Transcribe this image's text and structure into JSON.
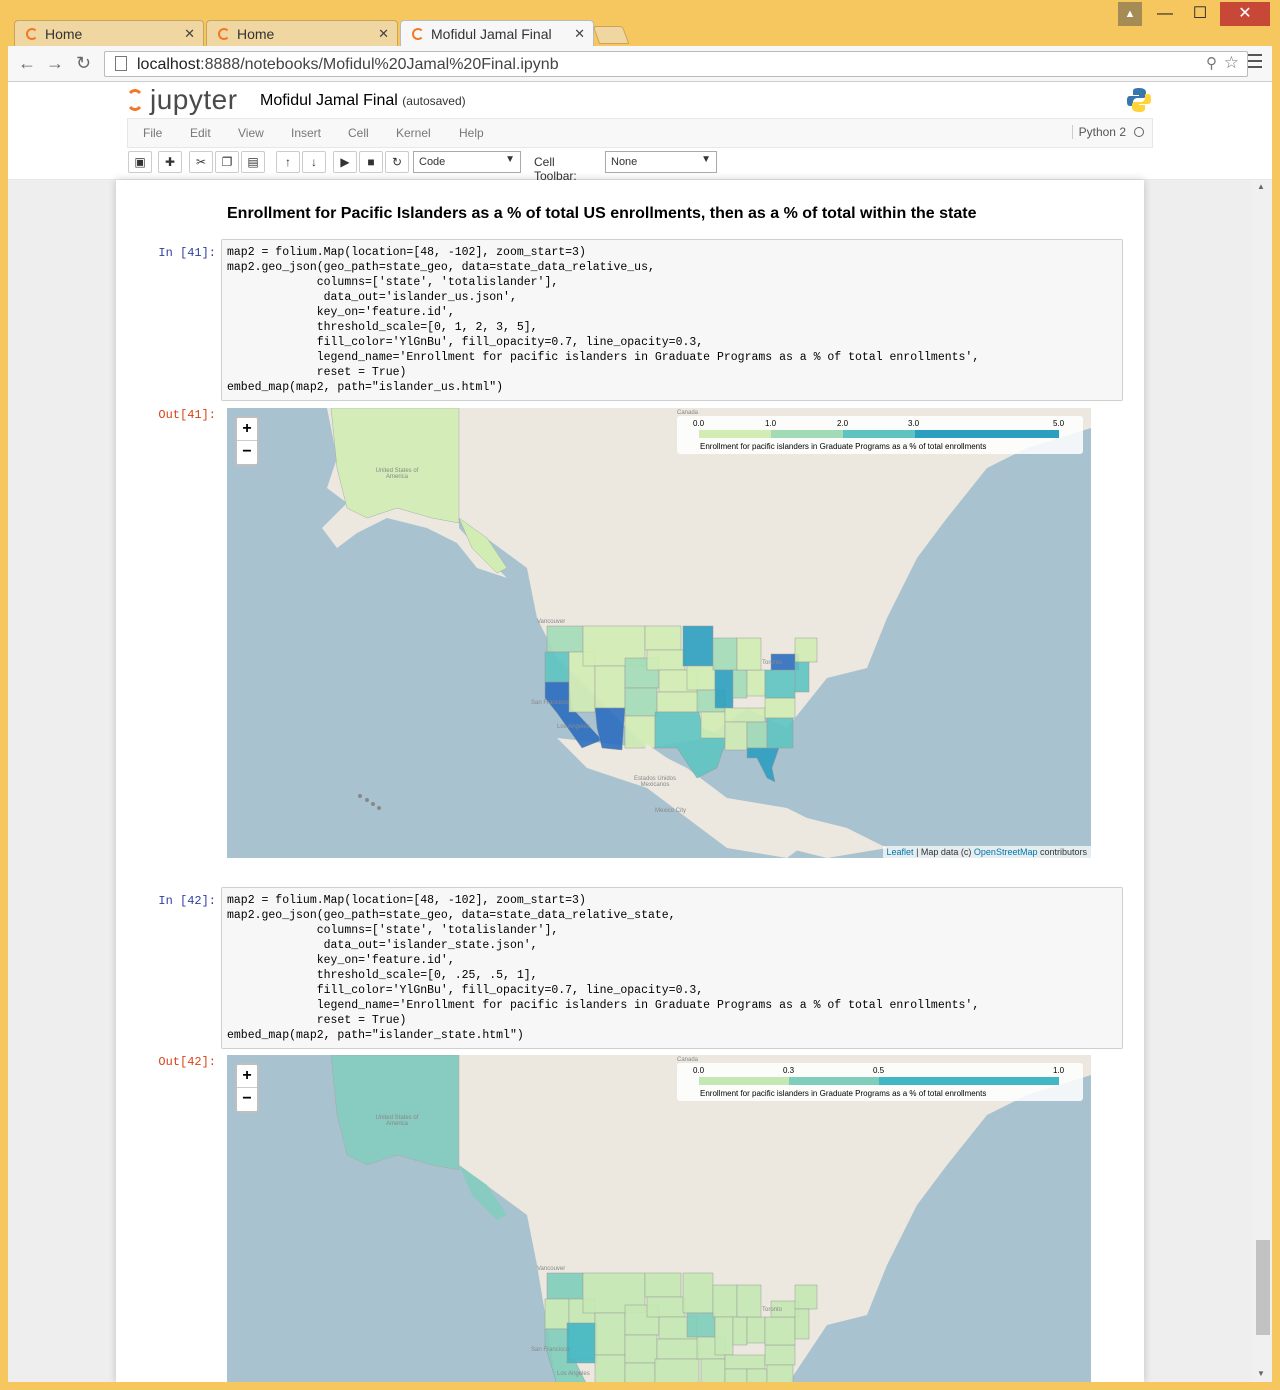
{
  "browser": {
    "tabs": [
      {
        "title": "Home"
      },
      {
        "title": "Home"
      },
      {
        "title": "Mofidul Jamal Final"
      }
    ],
    "url_host": "localhost",
    "url_path": ":8888/notebooks/Mofidul%20Jamal%20Final.ipynb"
  },
  "header": {
    "logo": "jupyter",
    "notebook_title": "Mofidul Jamal Final",
    "save_status": "(autosaved)"
  },
  "menu": {
    "items": [
      "File",
      "Edit",
      "View",
      "Insert",
      "Cell",
      "Kernel",
      "Help"
    ],
    "kernel_name": "Python 2"
  },
  "toolbar": {
    "cell_type": "Code",
    "cell_toolbar_label": "Cell Toolbar:",
    "cell_toolbar_value": "None"
  },
  "markdown_heading": "Enrollment for Pacific Islanders as a % of total US enrollments, then as a % of total within the state",
  "cells": [
    {
      "in_prompt": "In [41]:",
      "out_prompt": "Out[41]:",
      "code_lines": [
        "map2 = folium.Map(location=[48, -102], zoom_start=3)",
        "map2.geo_json(geo_path=state_geo, data=state_data_relative_us,",
        "             columns=['state', 'totalislander'],",
        "              data_out='islander_us.json',",
        "             key_on='feature.id',",
        "             threshold_scale=[0, 1, 2, 3, 5],",
        "             fill_color='YlGnBu', fill_opacity=0.7, line_opacity=0.3,",
        "             legend_name='Enrollment for pacific islanders in Graduate Programs as a % of total enrollments',",
        "             reset = True)",
        "embed_map(map2, path=\"islander_us.html\")"
      ],
      "legend_ticks": [
        "0.0",
        "1.0",
        "2.0",
        "3.0",
        "5.0"
      ],
      "legend_caption": "Enrollment for pacific islanders in Graduate Programs as a % of total enrollments"
    },
    {
      "in_prompt": "In [42]:",
      "out_prompt": "Out[42]:",
      "code_lines": [
        "map2 = folium.Map(location=[48, -102], zoom_start=3)",
        "map2.geo_json(geo_path=state_geo, data=state_data_relative_state,",
        "             columns=['state', 'totalislander'],",
        "              data_out='islander_state.json',",
        "             key_on='feature.id',",
        "             threshold_scale=[0, .25, .5, 1],",
        "             fill_color='YlGnBu', fill_opacity=0.7, line_opacity=0.3,",
        "             legend_name='Enrollment for pacific islanders in Graduate Programs as a % of total enrollments',",
        "             reset = True)",
        "embed_map(map2, path=\"islander_state.html\")"
      ],
      "legend_ticks": [
        "0.0",
        "0.3",
        "0.5",
        "1.0"
      ],
      "legend_caption": "Enrollment for pacific islanders in Graduate Programs as a % of total enrollments"
    }
  ],
  "map_labels": {
    "canada": "Canada",
    "usa": "United States of America",
    "vancouver": "Vancouver",
    "toronto": "Toronto",
    "san_francisco": "San Francisco",
    "los_angeles": "Los Angeles",
    "mexico": "Estados Unidos Mexicanos",
    "mexico_city": "Mexico City"
  },
  "attribution": {
    "leaflet": "Leaflet",
    "sep": " | Map data (c) ",
    "osm": "OpenStreetMap",
    "contributors": " contributors"
  },
  "zoom_in": "+",
  "zoom_out": "−",
  "colors": {
    "legend_1": [
      "#d2edb4",
      "#a3dbb7",
      "#5ec4c1",
      "#2c9ec0"
    ],
    "legend_2": [
      "#c4e8b4",
      "#7fcdbb",
      "#41b6c4"
    ]
  }
}
